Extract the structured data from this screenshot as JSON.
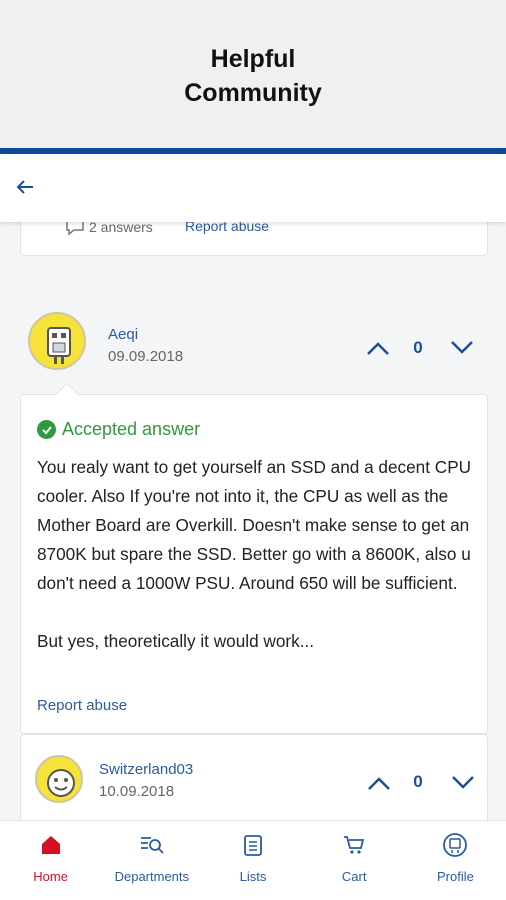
{
  "header": {
    "title": "Helpful\nCommunity"
  },
  "colors": {
    "brand_blue": "#0f4c97",
    "accent_red": "#d6101e",
    "accepted_green": "#2f9a3d",
    "link_blue": "#2a5aa0"
  },
  "previous_answer": {
    "answers_count": "2 answers",
    "report_label": "Report abuse"
  },
  "answer": {
    "user_name": "Aeqi",
    "date": "09.09.2018",
    "votes": "0",
    "accepted_label": "Accepted answer",
    "body": "You realy want to get yourself an SSD and a decent CPU cooler. Also If you're not into it, the CPU as well as the Mother Board are Overkill. Doesn't make sense to get an 8700K but spare the SSD. Better go with a 8600K, also u don't need a 1000W PSU. Around 650 will be sufficient.\n\nBut yes, theoretically it would work...",
    "report_label": "Report abuse"
  },
  "answer2": {
    "user_name": "Switzerland03",
    "date": "10.09.2018",
    "votes": "0"
  },
  "bottom_nav": [
    {
      "label": "Home",
      "icon": "home-icon",
      "active": true
    },
    {
      "label": "Departments",
      "icon": "departments-icon",
      "active": false
    },
    {
      "label": "Lists",
      "icon": "lists-icon",
      "active": false
    },
    {
      "label": "Cart",
      "icon": "cart-icon",
      "active": false
    },
    {
      "label": "Profile",
      "icon": "profile-icon",
      "active": false
    }
  ]
}
